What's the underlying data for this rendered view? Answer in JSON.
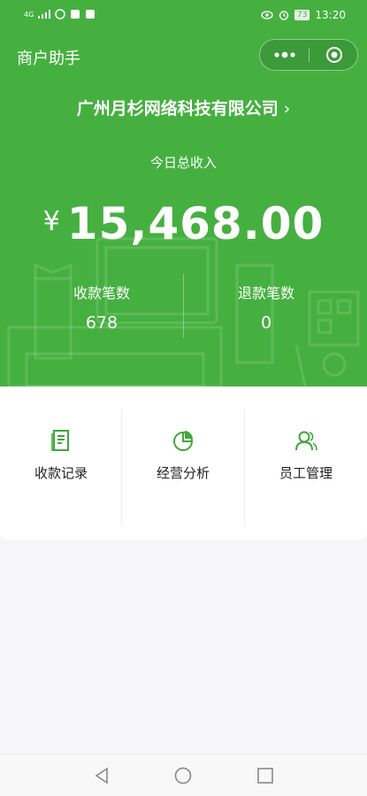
{
  "status_bar": {
    "signal": "4G",
    "time": "13:20",
    "battery": "73"
  },
  "nav": {
    "title": "商户助手",
    "icons": [
      "more-icon",
      "close-mini-program-icon"
    ]
  },
  "company": {
    "name": "广州月杉网络科技有限公司",
    "chevron": "›"
  },
  "income": {
    "label": "今日总收入",
    "currency": "¥",
    "amount": "15,468.00"
  },
  "stats": [
    {
      "label": "收款笔数",
      "value": "678"
    },
    {
      "label": "退款笔数",
      "value": "0"
    }
  ],
  "menu": [
    {
      "label": "收款记录",
      "icon": "receipt-icon"
    },
    {
      "label": "经营分析",
      "icon": "pie-chart-icon"
    },
    {
      "label": "员工管理",
      "icon": "staff-icon"
    }
  ],
  "colors": {
    "brand_green": "#45b040",
    "background": "#f6f6f8"
  }
}
